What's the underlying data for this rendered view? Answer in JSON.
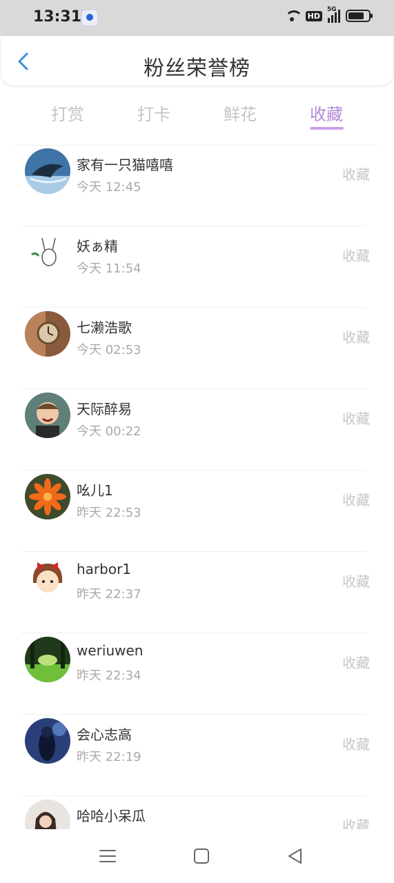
{
  "status_bar": {
    "time": "13:31",
    "hd_label": "HD",
    "network_label": "5G",
    "icons": [
      "baidu-app-icon",
      "wifi-icon",
      "hd-icon",
      "signal-icon",
      "battery-icon"
    ]
  },
  "header": {
    "title": "粉丝荣誉榜",
    "back_icon": "chevron-left-icon",
    "accent_color": "#3a8de0"
  },
  "tabs": [
    {
      "label": "打赏",
      "active": false
    },
    {
      "label": "打卡",
      "active": false
    },
    {
      "label": "鲜花",
      "active": false
    },
    {
      "label": "收藏",
      "active": true
    }
  ],
  "tab_active_color": "#b38ad9",
  "fans": [
    {
      "name": "家有一只猫嘻嘻",
      "time": "今天 12:45",
      "action": "收藏",
      "avatar": "whale-avatar"
    },
    {
      "name": "妖ぁ精",
      "time": "今天 11:54",
      "action": "收藏",
      "avatar": "rabbit-sketch-avatar"
    },
    {
      "name": "七濑浩歌",
      "time": "今天 02:53",
      "action": "收藏",
      "avatar": "pocket-watch-avatar"
    },
    {
      "name": "天际醉易",
      "time": "今天 00:22",
      "action": "收藏",
      "avatar": "child-photo-avatar"
    },
    {
      "name": "吆儿1",
      "time": "昨天 22:53",
      "action": "收藏",
      "avatar": "orange-flower-avatar"
    },
    {
      "name": "harbor1",
      "time": "昨天 22:37",
      "action": "收藏",
      "avatar": "cartoon-girl-avatar"
    },
    {
      "name": "weriuwen",
      "time": "昨天 22:34",
      "action": "收藏",
      "avatar": "forest-avatar"
    },
    {
      "name": "会心志高",
      "time": "昨天 22:19",
      "action": "收藏",
      "avatar": "night-figure-avatar"
    },
    {
      "name": "哈哈小呆瓜",
      "time": "",
      "action": "收藏",
      "avatar": "person-photo-avatar"
    }
  ],
  "nav_bar": {
    "icons": [
      "menu-icon",
      "home-square-icon",
      "back-triangle-icon"
    ]
  }
}
